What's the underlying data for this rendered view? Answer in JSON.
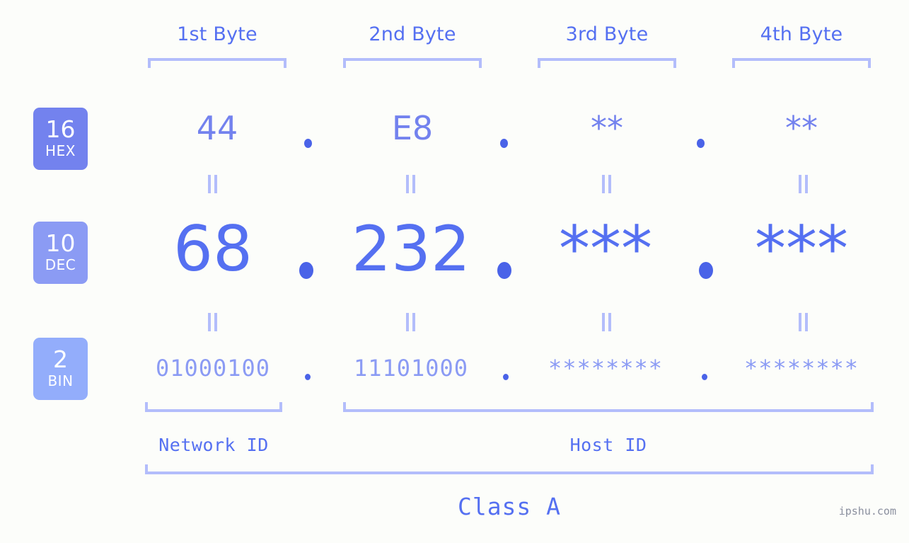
{
  "background_color": "#fcfdfa",
  "accent_color": "#5570f1",
  "bracket_color": "#b3bdfb",
  "bytes": [
    {
      "label": "1st Byte"
    },
    {
      "label": "2nd Byte"
    },
    {
      "label": "3rd Byte"
    },
    {
      "label": "4th Byte"
    }
  ],
  "bases": [
    {
      "num": "16",
      "name": "HEX",
      "color": "#7382ee"
    },
    {
      "num": "10",
      "name": "DEC",
      "color": "#8b9bf4"
    },
    {
      "num": "2",
      "name": "BIN",
      "color": "#93adfb"
    }
  ],
  "rows": {
    "hex": {
      "base_label": "16",
      "base_name": "HEX",
      "values": [
        "44",
        "E8",
        "**",
        "**"
      ],
      "separator": "."
    },
    "dec": {
      "base_label": "10",
      "base_name": "DEC",
      "values": [
        "68",
        "232",
        "***",
        "***"
      ],
      "separator": "."
    },
    "bin": {
      "base_label": "2",
      "base_name": "BIN",
      "values": [
        "01000100",
        "11101000",
        "********",
        "********"
      ],
      "separator": "."
    }
  },
  "equals_marks": {
    "glyph": "||",
    "count_per_row": 4
  },
  "segments": {
    "network_id": "Network ID",
    "host_id": "Host ID",
    "class": "Class A"
  },
  "watermark": "ipshu.com"
}
